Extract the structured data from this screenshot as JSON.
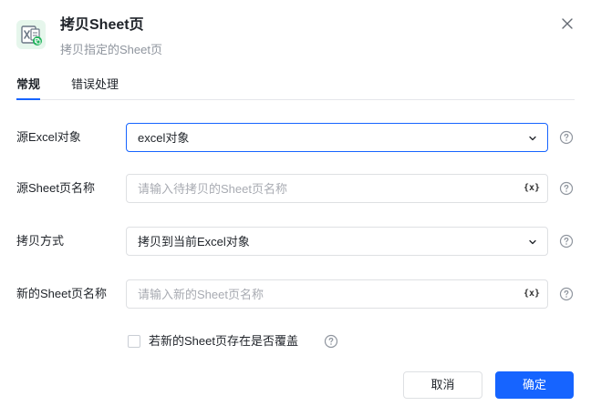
{
  "header": {
    "title": "拷贝Sheet页",
    "subtitle": "拷贝指定的Sheet页",
    "icon": "excel-sheet-copy-icon",
    "accent_color": "#1fb35a"
  },
  "tabs": [
    {
      "label": "常规",
      "active": true
    },
    {
      "label": "错误处理",
      "active": false
    }
  ],
  "form": {
    "source_excel": {
      "label": "源Excel对象",
      "value": "excel对象"
    },
    "source_sheet": {
      "label": "源Sheet页名称",
      "placeholder": "请输入待拷贝的Sheet页名称",
      "var_icon": "{x}"
    },
    "copy_mode": {
      "label": "拷贝方式",
      "value": "拷贝到当前Excel对象"
    },
    "new_sheet": {
      "label": "新的Sheet页名称",
      "placeholder": "请输入新的Sheet页名称",
      "var_icon": "{x}"
    },
    "overwrite": {
      "label": "若新的Sheet页存在是否覆盖",
      "checked": false
    }
  },
  "footer": {
    "cancel_label": "取消",
    "ok_label": "确定",
    "primary_color": "#1664ff"
  }
}
